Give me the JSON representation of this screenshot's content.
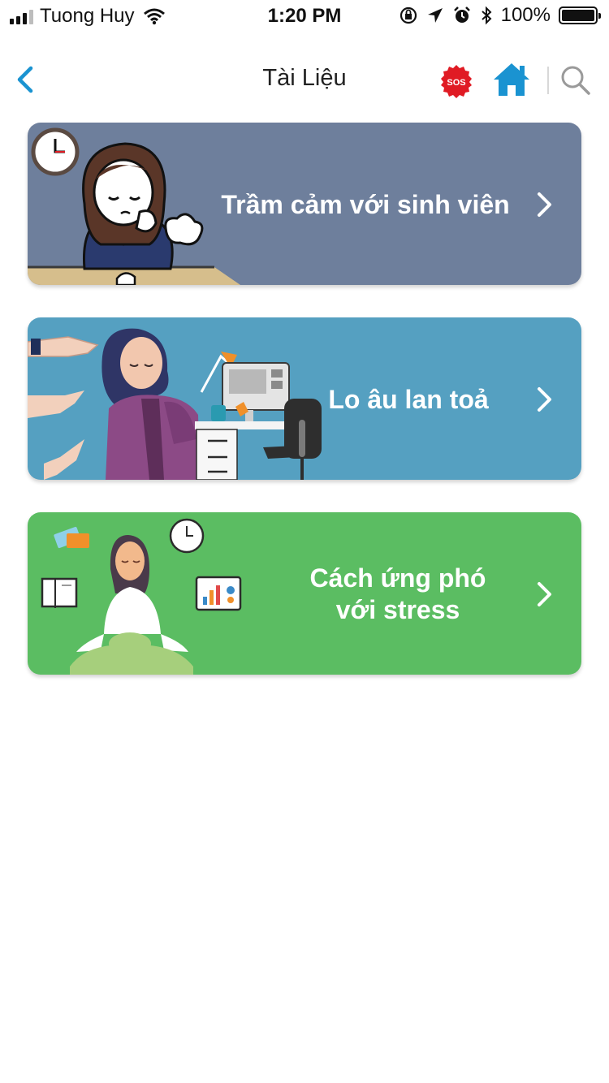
{
  "status_bar": {
    "carrier": "Tuong Huy",
    "time": "1:20 PM",
    "battery": "100%"
  },
  "nav": {
    "title": "Tài Liệu",
    "sos_label": "SOS"
  },
  "cards": [
    {
      "title": "Trầm cảm với sinh viên",
      "color": "#6e7f9c"
    },
    {
      "title": "Lo âu lan toả",
      "color": "#55a0c1"
    },
    {
      "title_line1": "Cách ứng phó",
      "title_line2": "với stress",
      "color": "#5bbd62"
    }
  ],
  "colors": {
    "accent": "#1a93d1",
    "sos": "#e01b24"
  },
  "icons": [
    "back-chevron-icon",
    "sos-icon",
    "home-icon",
    "search-icon",
    "chevron-right-icon"
  ]
}
